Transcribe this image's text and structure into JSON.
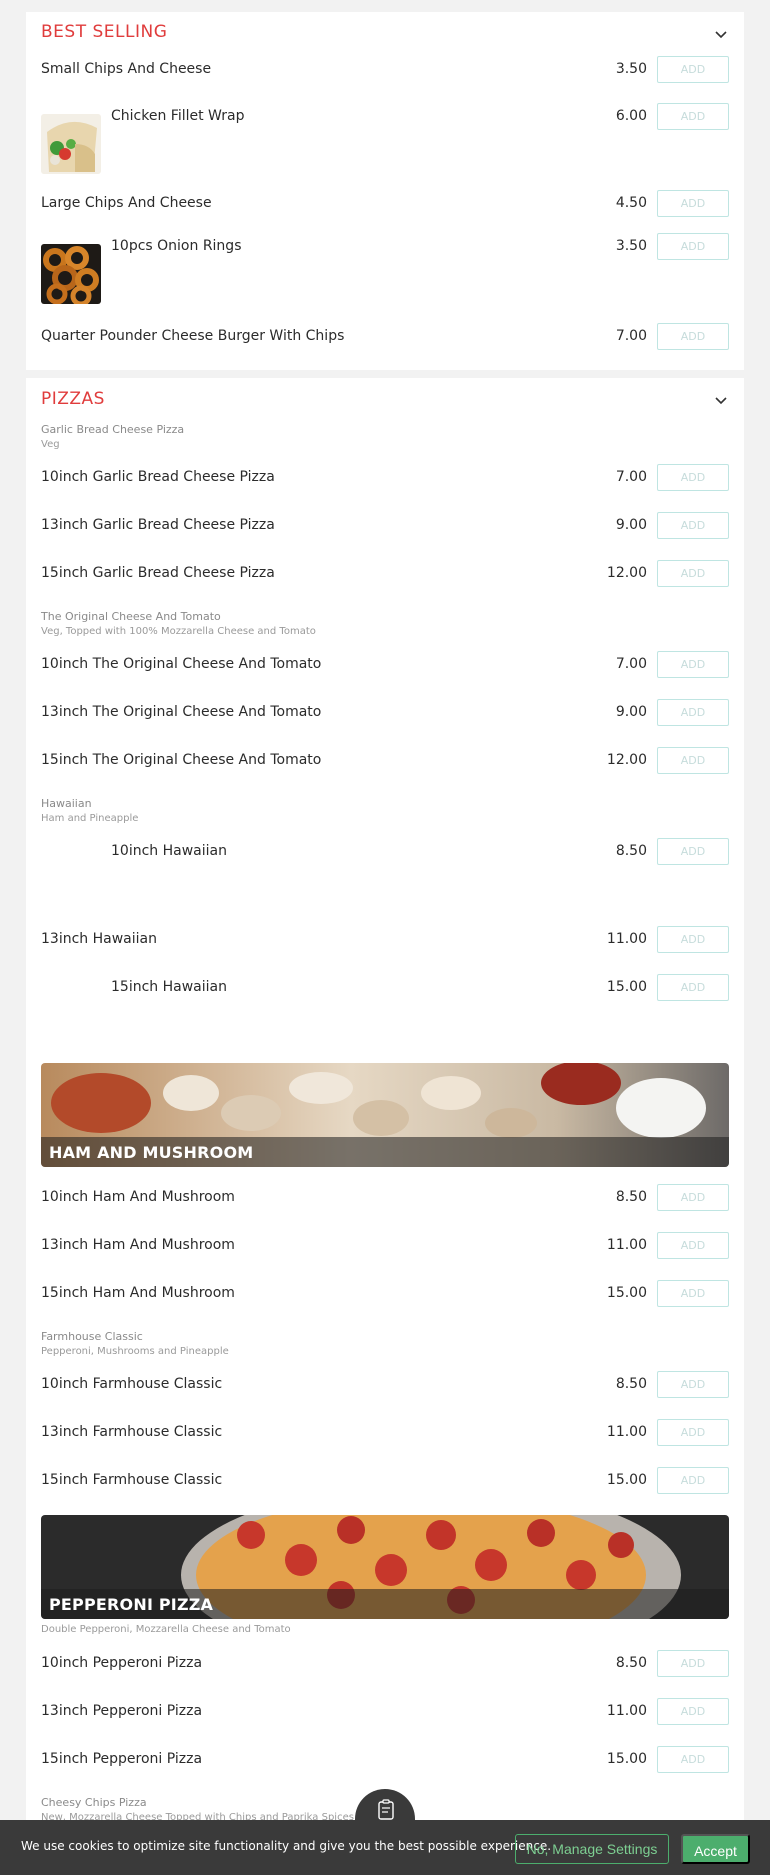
{
  "best_selling": {
    "title": "BEST SELLING",
    "items": [
      {
        "name": "Small Chips And Cheese",
        "price": "3.50"
      },
      {
        "name": "Chicken Fillet Wrap",
        "price": "6.00"
      },
      {
        "name": "Large Chips And Cheese",
        "price": "4.50"
      },
      {
        "name": "10pcs Onion Rings",
        "price": "3.50"
      },
      {
        "name": "Quarter Pounder Cheese Burger With Chips",
        "price": "7.00"
      }
    ]
  },
  "pizzas": {
    "title": "PIZZAS",
    "garlic": {
      "group": "Garlic Bread Cheese Pizza",
      "desc": "Veg",
      "items": [
        {
          "name": "10inch Garlic Bread Cheese Pizza",
          "price": "7.00"
        },
        {
          "name": "13inch Garlic Bread Cheese Pizza",
          "price": "9.00"
        },
        {
          "name": "15inch Garlic Bread Cheese Pizza",
          "price": "12.00"
        }
      ]
    },
    "original": {
      "group": "The Original Cheese And Tomato",
      "desc": "Veg, Topped with 100% Mozzarella Cheese and Tomato",
      "items": [
        {
          "name": "10inch The Original Cheese And Tomato",
          "price": "7.00"
        },
        {
          "name": "13inch The Original Cheese And Tomato",
          "price": "9.00"
        },
        {
          "name": "15inch The Original Cheese And Tomato",
          "price": "12.00"
        }
      ]
    },
    "hawaiian": {
      "group": "Hawaiian",
      "desc": "Ham and Pineapple",
      "items": [
        {
          "name": "10inch Hawaiian",
          "price": "8.50"
        },
        {
          "name": "13inch Hawaiian",
          "price": "11.00"
        },
        {
          "name": "15inch Hawaiian",
          "price": "15.00"
        }
      ]
    },
    "ham_mushroom": {
      "banner": "HAM AND MUSHROOM",
      "items": [
        {
          "name": "10inch Ham And Mushroom",
          "price": "8.50"
        },
        {
          "name": "13inch Ham And Mushroom",
          "price": "11.00"
        },
        {
          "name": "15inch Ham And Mushroom",
          "price": "15.00"
        }
      ]
    },
    "farmhouse": {
      "group": "Farmhouse Classic",
      "desc": "Pepperoni, Mushrooms and Pineapple",
      "items": [
        {
          "name": "10inch Farmhouse Classic",
          "price": "8.50"
        },
        {
          "name": "13inch Farmhouse Classic",
          "price": "11.00"
        },
        {
          "name": "15inch Farmhouse Classic",
          "price": "15.00"
        }
      ]
    },
    "pepperoni": {
      "banner": "PEPPERONI PIZZA",
      "desc": "Double Pepperoni, Mozzarella Cheese and Tomato",
      "items": [
        {
          "name": "10inch Pepperoni Pizza",
          "price": "8.50"
        },
        {
          "name": "13inch Pepperoni Pizza",
          "price": "11.00"
        },
        {
          "name": "15inch Pepperoni Pizza",
          "price": "15.00"
        }
      ]
    },
    "cheesy_chips": {
      "group": "Cheesy Chips Pizza",
      "desc": "New, Mozzarella Cheese Topped with Chips and Paprika Spices"
    }
  },
  "add_label": "ADD",
  "cookie": {
    "message": "We use cookies to optimize site functionality and give you the best possible experience.",
    "manage_label": "No, Manage Settings",
    "accept_label": "Accept"
  },
  "icons": {
    "collapse": "chevron-down-icon",
    "basket": "basket-icon"
  },
  "colors": {
    "accent": "#e03c3c",
    "add_border": "#bfe5e2",
    "accept": "#4cae6d"
  }
}
